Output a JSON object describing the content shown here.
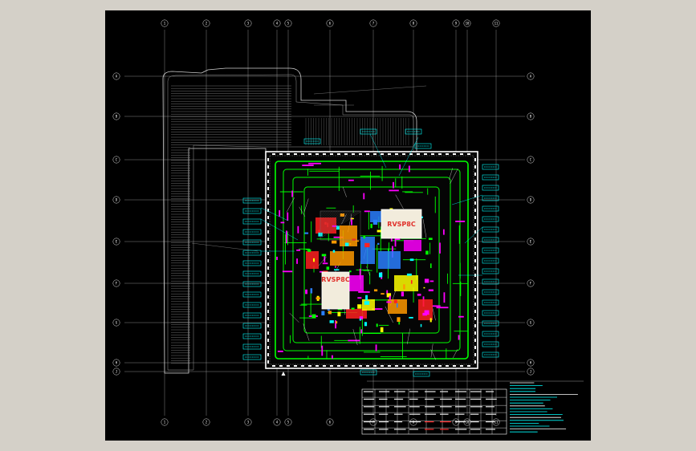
{
  "viewport": {
    "background": "#d4d0c8",
    "paper": "#000000"
  },
  "grid": {
    "top_labels": [
      "1",
      "2",
      "3",
      "4",
      "5",
      "6",
      "7",
      "8",
      "9",
      "10",
      "11"
    ],
    "left_labels": [
      "A",
      "B",
      "C",
      "D",
      "E",
      "F",
      "G",
      "H",
      "J"
    ]
  },
  "stamps": [
    "RVSP8C",
    "RVSP8C"
  ],
  "colors": {
    "wall": "#ffffff",
    "pipe": "#00ff00",
    "duct": "#ff00ff",
    "tag": "#00ffff",
    "equip_red": "#ff2020",
    "equip_orange": "#ff9900",
    "equip_blue": "#2a7fff",
    "equip_yellow": "#ffff00"
  },
  "icons": [
    "grid-bubble-icon",
    "north-arrow-icon"
  ]
}
